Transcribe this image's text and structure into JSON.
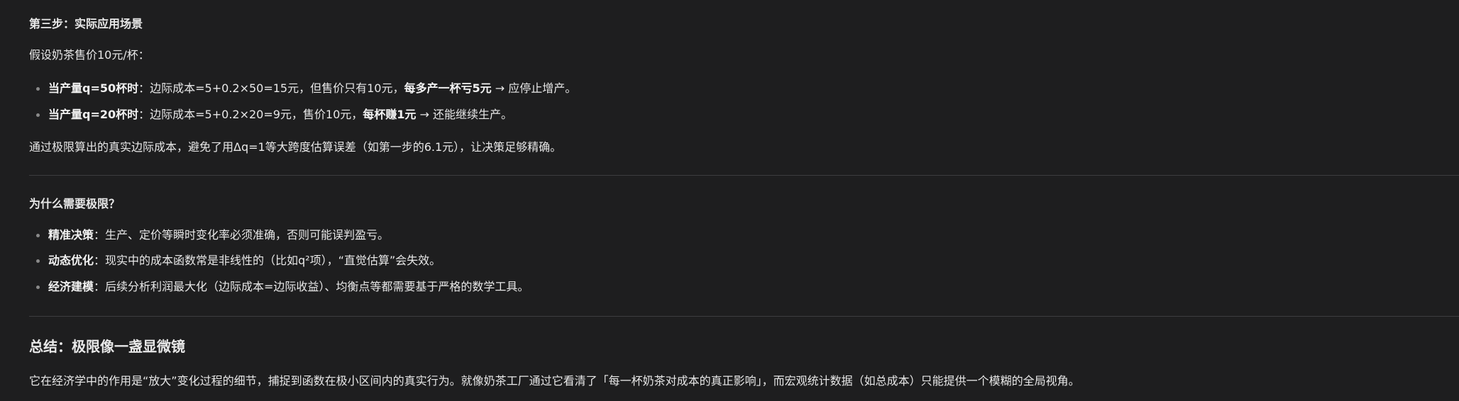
{
  "step3": {
    "heading": "第三步：实际应用场景",
    "intro": "假设奶茶售价10元/杯：",
    "bullets": [
      {
        "bold": "当产量q=50杯时",
        "text1": "：边际成本=5+0.2×50=15元，但售价只有10元，",
        "bold2": "每多产一杯亏5元",
        "text2": " → 应停止增产。"
      },
      {
        "bold": "当产量q=20杯时",
        "text1": "：边际成本=5+0.2×20=9元，售价10元，",
        "bold2": "每杯赚1元",
        "text2": " → 还能继续生产。"
      }
    ],
    "summary": "通过极限算出的真实边际成本，避免了用Δq=1等大跨度估算误差（如第一步的6.1元），让决策足够精确。"
  },
  "why": {
    "heading": "为什么需要极限？",
    "bullets": [
      {
        "bold": "精准决策",
        "text": "：生产、定价等瞬时变化率必须准确，否则可能误判盈亏。"
      },
      {
        "bold": "动态优化",
        "text": "：现实中的成本函数常是非线性的（比如q²项），“直觉估算”会失效。"
      },
      {
        "bold": "经济建模",
        "text": "：后续分析利润最大化（边际成本=边际收益）、均衡点等都需要基于严格的数学工具。"
      }
    ]
  },
  "conclusion": {
    "heading": "总结：极限像一盏显微镜",
    "text": "它在经济学中的作用是“放大”变化过程的细节，捕捉到函数在极小区间内的真实行为。就像奶茶工厂通过它看清了「每一杯奶茶对成本的真正影响」，而宏观统计数据（如总成本）只能提供一个模糊的全局视角。"
  }
}
